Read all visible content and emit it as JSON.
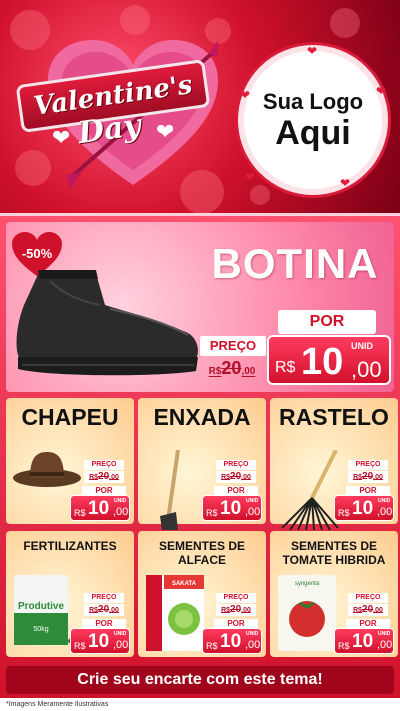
{
  "header": {
    "valentine_line1": "Valentine's",
    "valentine_line2": "Day",
    "logo_line1": "Sua Logo",
    "logo_line2": "Aqui"
  },
  "featured": {
    "discount": "-50%",
    "title": "BOTINA",
    "por_label": "POR",
    "preco_label": "PREÇO",
    "old_price_prefix": "R$",
    "old_price_int": "20",
    "old_price_dec": ",00",
    "currency": "R$",
    "price_int": "10",
    "price_dec": ",00",
    "unit": "UNID"
  },
  "products": [
    {
      "title": "CHAPEU",
      "preco_label": "PREÇO",
      "old_prefix": "R$",
      "old_int": "20",
      "old_dec": ",00",
      "por_label": "POR",
      "currency": "R$",
      "price_int": "10",
      "price_dec": ",00",
      "unit": "UNID",
      "image": "hat"
    },
    {
      "title": "ENXADA",
      "preco_label": "PREÇO",
      "old_prefix": "R$",
      "old_int": "20",
      "old_dec": ",00",
      "por_label": "POR",
      "currency": "R$",
      "price_int": "10",
      "price_dec": ",00",
      "unit": "UNID",
      "image": "hoe"
    },
    {
      "title": "RASTELO",
      "preco_label": "PREÇO",
      "old_prefix": "R$",
      "old_int": "20",
      "old_dec": ",00",
      "por_label": "POR",
      "currency": "R$",
      "price_int": "10",
      "price_dec": ",00",
      "unit": "UNID",
      "image": "rake"
    },
    {
      "title": "FERTILIZANTES",
      "preco_label": "PREÇO",
      "old_prefix": "R$",
      "old_int": "20",
      "old_dec": ",00",
      "por_label": "POR",
      "currency": "R$",
      "price_int": "10",
      "price_dec": ",00",
      "unit": "UNID",
      "image": "fertilizer-bag",
      "bag_label": "Produtive",
      "bag_weight": "50kg"
    },
    {
      "title": "SEMENTES DE ALFACE",
      "preco_label": "PREÇO",
      "old_prefix": "R$",
      "old_int": "20",
      "old_dec": ",00",
      "por_label": "POR",
      "currency": "R$",
      "price_int": "10",
      "price_dec": ",00",
      "unit": "UNID",
      "image": "lettuce-seeds",
      "brand": "SAKATA"
    },
    {
      "title": "SEMENTES DE TOMATE HIBRIDA",
      "preco_label": "PREÇO",
      "old_prefix": "R$",
      "old_int": "20",
      "old_dec": ",00",
      "por_label": "POR",
      "currency": "R$",
      "price_int": "10",
      "price_dec": ",00",
      "unit": "UNID",
      "image": "tomato-seeds",
      "brand": "syngenta"
    }
  ],
  "cta": "Crie seu encarte com este tema!",
  "footer": "*Imagens Meramente Ilustrativas",
  "colors": {
    "primary": "#d0112b",
    "pink": "#ff8fae",
    "card": "#ffd9a6",
    "white": "#ffffff"
  }
}
